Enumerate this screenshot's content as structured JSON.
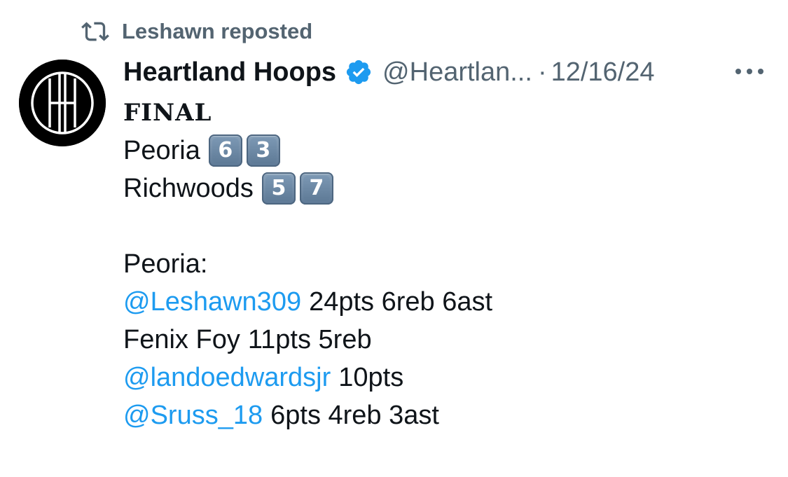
{
  "repost": {
    "icon": "repost-icon",
    "label": "Leshawn reposted"
  },
  "author": {
    "avatar_icon": "hh-monogram-logo",
    "name": "Heartland Hoops",
    "verified": true,
    "verified_color": "#1d9bf0",
    "handle": "@Heartlan...",
    "separator": "·",
    "date": "12/16/24",
    "more_icon": "more-horizontal-icon"
  },
  "post": {
    "headline": "FINAL",
    "scores": [
      {
        "team": "Peoria",
        "digits": [
          "6",
          "3"
        ]
      },
      {
        "team": "Richwoods",
        "digits": [
          "5",
          "7"
        ]
      }
    ],
    "section_label": "Peoria:",
    "players": [
      {
        "name": "@Leshawn309",
        "is_mention": true,
        "stats": "24pts 6reb 6ast"
      },
      {
        "name": "Fenix Foy",
        "is_mention": false,
        "stats": "11pts 5reb"
      },
      {
        "name": "@landoedwardsjr",
        "is_mention": true,
        "stats": "10pts"
      },
      {
        "name": "@Sruss_18",
        "is_mention": true,
        "stats": "6pts 4reb 3ast"
      }
    ]
  },
  "colors": {
    "text": "#0f1419",
    "secondary": "#536471",
    "mention": "#1d9bf0",
    "keycap": "#6f8ba7"
  }
}
